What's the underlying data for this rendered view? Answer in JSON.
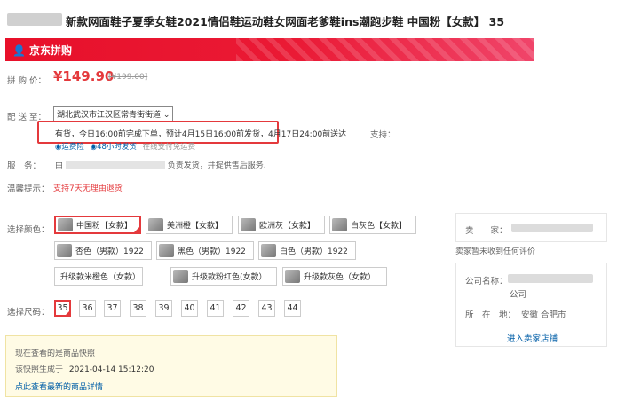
{
  "product_title": "新款网面鞋子夏季女鞋2021情侣鞋运动鞋女网面老爹鞋ins潮跑步鞋 中国粉【女款】 35",
  "banner": {
    "label": "京东拼购"
  },
  "price": {
    "label": "拼 购 价：",
    "value": "¥149.90",
    "original": "[¥199.00]"
  },
  "delivery": {
    "label": "配 送 至：",
    "location": "湖北武汉市江汉区常青街街道",
    "stock_text": "有货，今日16:00前完成下单，预计4月15日16:00前发货，4月17日24:00前送达",
    "support_label": "支持：",
    "badges": [
      "运费险",
      "48小时发货",
      "在线支付免运费"
    ]
  },
  "service": {
    "label": "服　务：",
    "text_prefix": "由",
    "text_suffix": "负责发货，并提供售后服务."
  },
  "tip": {
    "label": "温馨提示：",
    "text": "支持7天无理由退货"
  },
  "color": {
    "label": "选择颜色：",
    "options": [
      "中国粉【女款】",
      "美洲橙【女款】",
      "欧洲灰【女款】",
      "白灰色【女款】",
      "杏色（男款）1922",
      "黑色（男款）1922",
      "白色（男款）1922",
      "升级款米橙色（女款）",
      "升级款粉红色(女款）",
      "升级款灰色（女款）"
    ]
  },
  "size": {
    "label": "选择尺码：",
    "options": [
      "35",
      "36",
      "37",
      "38",
      "39",
      "40",
      "41",
      "42",
      "43",
      "44"
    ]
  },
  "snapshot": {
    "line1": "现在查看的是商品快照",
    "line2_label": "该快照生成于",
    "line2_time": "2021-04-14 15:12:20",
    "link": "点此查看最新的商品详情"
  },
  "seller": {
    "seller_label": "卖　　家：",
    "no_review": "卖家暂未收到任何评价",
    "company_label": "公司名称：",
    "company_suffix": "公司",
    "location_label": "所　在　地：",
    "location": "安徽 合肥市",
    "enter_store": "进入卖家店铺"
  }
}
